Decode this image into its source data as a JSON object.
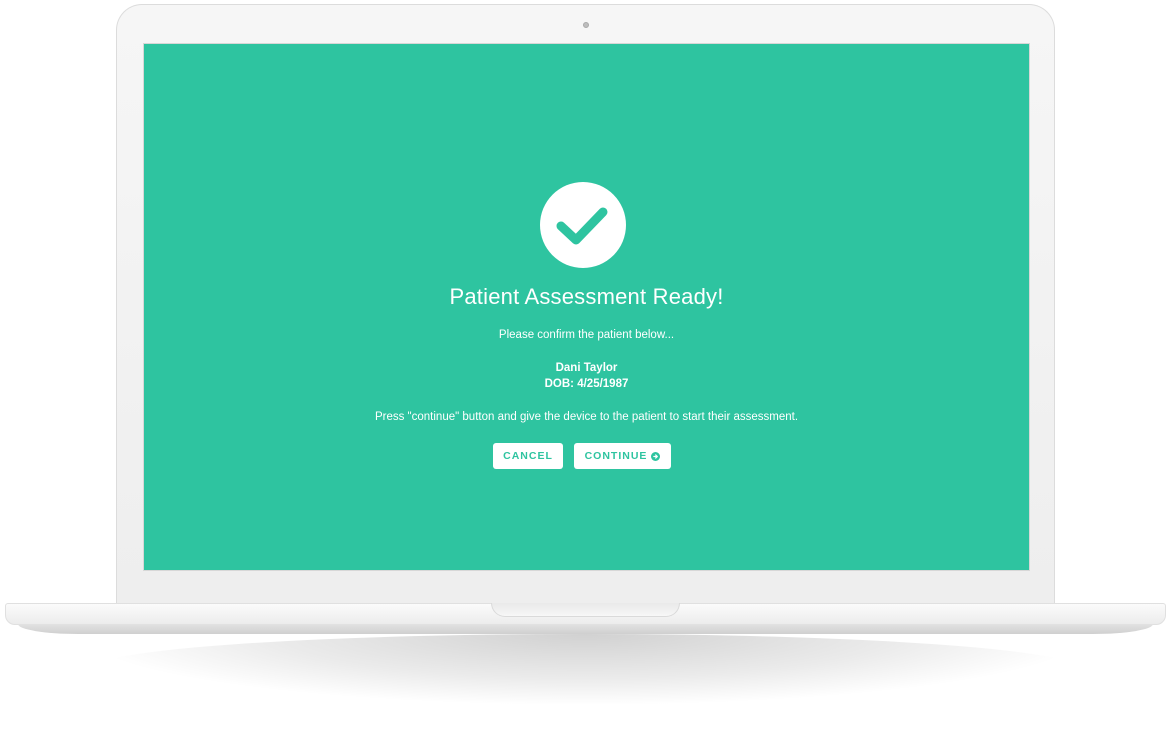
{
  "screen": {
    "title": "Patient Assessment Ready!",
    "subtitle": "Please confirm the patient below...",
    "patient": {
      "name": "Dani Taylor",
      "dob": "DOB: 4/25/1987"
    },
    "instruction": "Press \"continue\" button and give the device to the patient to start their assessment.",
    "buttons": {
      "cancel_label": "CANCEL",
      "continue_label": "CONTINUE"
    },
    "icons": {
      "status": "check-circle-icon",
      "continue": "arrow-circle-right-icon"
    }
  },
  "colors": {
    "accent": "#2ec4a0",
    "text": "#ffffff",
    "button_bg": "#ffffff"
  }
}
